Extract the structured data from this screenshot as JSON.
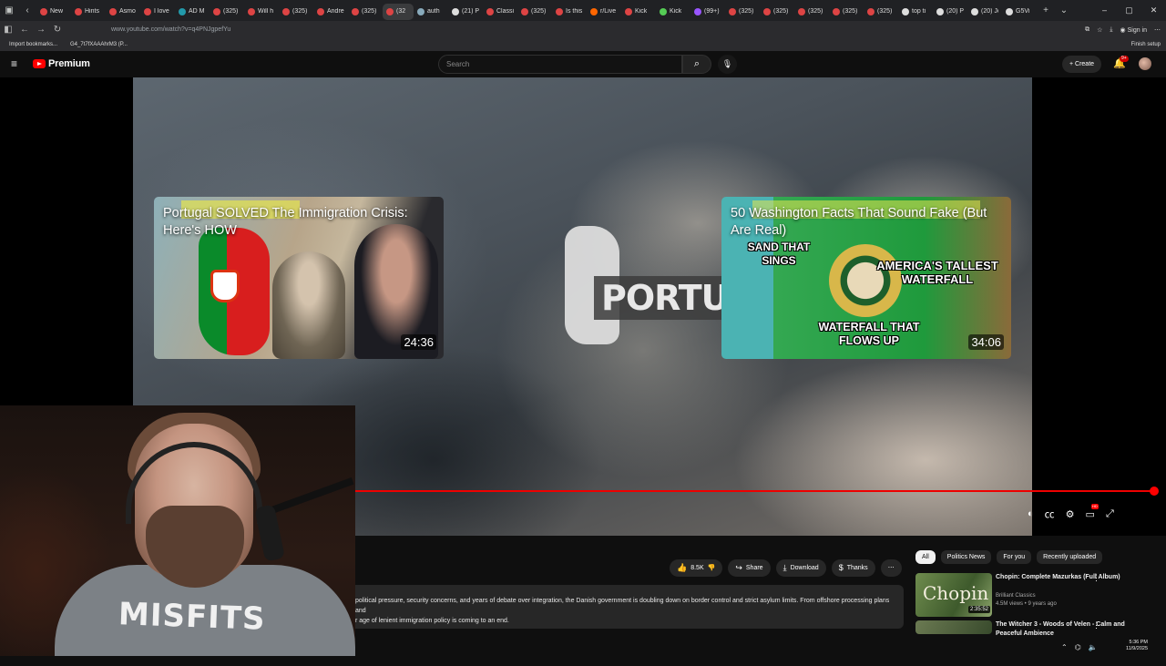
{
  "browser": {
    "tabs": [
      {
        "label": "New",
        "color": "#d44"
      },
      {
        "label": "Hints",
        "color": "#d44"
      },
      {
        "label": "Asmo",
        "color": "#d44"
      },
      {
        "label": "I love",
        "color": "#d44"
      },
      {
        "label": "AD M",
        "color": "#29a"
      },
      {
        "label": "(325)",
        "color": "#d44"
      },
      {
        "label": "Will h",
        "color": "#d44"
      },
      {
        "label": "(325)",
        "color": "#d44"
      },
      {
        "label": "Andre",
        "color": "#d44"
      },
      {
        "label": "(325)",
        "color": "#d44"
      },
      {
        "label": "(32",
        "color": "#d44",
        "active": true
      },
      {
        "label": "auth",
        "color": "#8ab"
      },
      {
        "label": "(21) P",
        "color": "#ddd"
      },
      {
        "label": "Classi",
        "color": "#d44"
      },
      {
        "label": "(325)",
        "color": "#d44"
      },
      {
        "label": "Is this",
        "color": "#d44"
      },
      {
        "label": "r/Live",
        "color": "#f60"
      },
      {
        "label": "Kick",
        "color": "#d44"
      },
      {
        "label": "Kick",
        "color": "#5c5"
      },
      {
        "label": "(99+)",
        "color": "#95f"
      },
      {
        "label": "(325)",
        "color": "#d44"
      },
      {
        "label": "(325)",
        "color": "#d44"
      },
      {
        "label": "(325)",
        "color": "#d44"
      },
      {
        "label": "(325)",
        "color": "#d44"
      },
      {
        "label": "(325)",
        "color": "#d44"
      },
      {
        "label": "top ti",
        "color": "#ddd"
      },
      {
        "label": "(20) P",
        "color": "#ddd"
      },
      {
        "label": "(20) Jo",
        "color": "#ddd"
      },
      {
        "label": "G5Vi",
        "color": "#ddd"
      }
    ],
    "url": "www.youtube.com/watch?v=q4PNJgpefYu",
    "sign_in": "Sign in",
    "bookmarks": [
      {
        "label": "Import bookmarks..."
      },
      {
        "label": "G4_7t7fXAAAhrM3 (P..."
      }
    ],
    "finish_setup": "Finish setup"
  },
  "youtube": {
    "logo_text": "Premium",
    "search_placeholder": "Search",
    "create_label": "+ Create",
    "notification_count": "9+"
  },
  "player": {
    "map_label": "PORTUGA",
    "progress_fraction": 1.0,
    "endcards": [
      {
        "title": "Portugal SOLVED The Immigration Crisis: Here's HOW",
        "duration": "24:36"
      },
      {
        "title": "50 Washington Facts That Sound Fake (But Are Real)",
        "duration": "34:06",
        "thumb_labels": [
          "SAND THAT SINGS",
          "AMERICA'S TALLEST WATERFALL",
          "WATERFALL THAT FLOWS UP"
        ]
      }
    ],
    "hd_badge": "HD"
  },
  "actions": {
    "likes": "8.5K",
    "share": "Share",
    "download": "Download",
    "thanks": "Thanks"
  },
  "description": {
    "line1": "political pressure, security concerns, and years of debate over integration, the Danish government is doubling down on border control and strict asylum limits. From offshore processing plans and",
    "line2": "r age of lenient immigration policy is coming to an end."
  },
  "sidebar": {
    "chips": [
      {
        "label": "All",
        "selected": true
      },
      {
        "label": "Politics News"
      },
      {
        "label": "For you"
      },
      {
        "label": "Recently uploaded"
      }
    ],
    "recommendations": [
      {
        "title": "Chopin: Complete Mazurkas (Full Album)",
        "channel": "Brilliant Classics",
        "meta": "4.5M views • 9 years ago",
        "duration": "2:35:52",
        "thumb_text": "Chopin"
      },
      {
        "title": "The Witcher 3 - Woods of Velen - Calm and Peaceful Ambience",
        "channel": "",
        "meta": "",
        "duration": "",
        "thumb_text": ""
      }
    ]
  },
  "taskbar": {
    "time": "5:36 PM",
    "date": "11/9/2025"
  }
}
